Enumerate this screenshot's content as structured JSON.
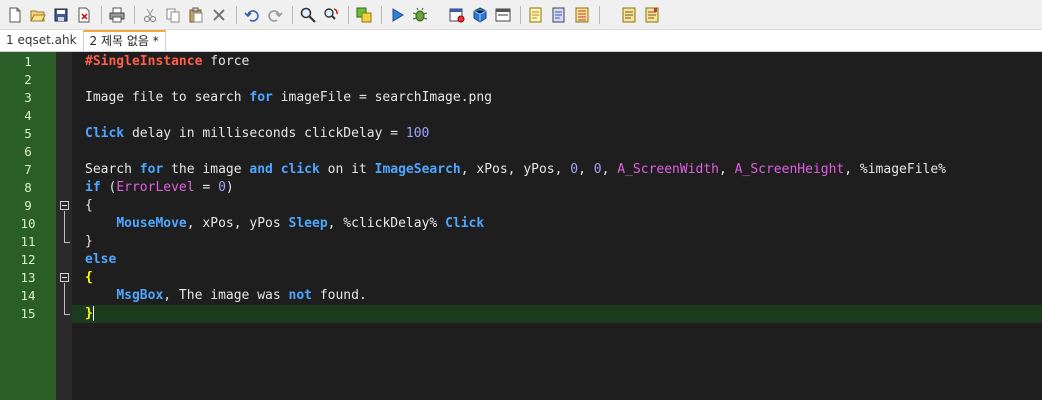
{
  "toolbar": {
    "buttons": [
      {
        "name": "new-file-icon",
        "icon": "new-file"
      },
      {
        "name": "open-folder-icon",
        "icon": "open-folder"
      },
      {
        "name": "save-icon",
        "icon": "save"
      },
      {
        "name": "close-file-icon",
        "icon": "close-file"
      },
      {
        "name": "print-icon",
        "icon": "print"
      },
      {
        "name": "cut-icon",
        "icon": "cut"
      },
      {
        "name": "copy-icon",
        "icon": "copy"
      },
      {
        "name": "paste-icon",
        "icon": "paste"
      },
      {
        "name": "delete-icon",
        "icon": "delete"
      },
      {
        "name": "undo-icon",
        "icon": "undo"
      },
      {
        "name": "redo-icon",
        "icon": "redo"
      },
      {
        "name": "find-icon",
        "icon": "find"
      },
      {
        "name": "replace-icon",
        "icon": "replace"
      },
      {
        "name": "language-icon",
        "icon": "language"
      },
      {
        "name": "run-icon",
        "icon": "run"
      },
      {
        "name": "debug-icon",
        "icon": "debug"
      },
      {
        "name": "window-spy-icon",
        "icon": "window-spy"
      },
      {
        "name": "compile-icon",
        "icon": "compile"
      },
      {
        "name": "window-icon",
        "icon": "window"
      },
      {
        "name": "notes-icon",
        "icon": "notes"
      },
      {
        "name": "reference-icon",
        "icon": "reference"
      },
      {
        "name": "doc-list-icon",
        "icon": "doc-list"
      },
      {
        "name": "bookmark-icon",
        "icon": "bookmark"
      },
      {
        "name": "bookmark-list-icon",
        "icon": "bookmark-list"
      }
    ]
  },
  "tabs": [
    {
      "label": "1 eqset.ahk",
      "active": false
    },
    {
      "label": "2 제목 없음 *",
      "active": true
    }
  ],
  "editor": {
    "line_numbers": [
      "1",
      "2",
      "3",
      "4",
      "5",
      "6",
      "7",
      "8",
      "9",
      "10",
      "11",
      "12",
      "13",
      "14",
      "15"
    ],
    "colors": {
      "gutter": "#2b5d27",
      "background": "#1e1e1e",
      "keyword": "#4fa6ff",
      "directive": "#ff5e4a",
      "variable": "#e060e0",
      "number": "#a0a0ff",
      "brace": "#ffff00"
    },
    "lines": [
      [
        {
          "t": "#SingleInstance",
          "c": "dir"
        },
        {
          "t": " force",
          "c": "plain"
        }
      ],
      [],
      [
        {
          "t": "Image file to search ",
          "c": "plain"
        },
        {
          "t": "for",
          "c": "kw"
        },
        {
          "t": " imageFile = searchImage.png",
          "c": "plain"
        }
      ],
      [],
      [
        {
          "t": "Click",
          "c": "cmd"
        },
        {
          "t": " delay in milliseconds clickDelay = ",
          "c": "plain"
        },
        {
          "t": "100",
          "c": "num"
        }
      ],
      [],
      [
        {
          "t": "Search ",
          "c": "plain"
        },
        {
          "t": "for",
          "c": "kw"
        },
        {
          "t": " the image ",
          "c": "plain"
        },
        {
          "t": "and",
          "c": "kw"
        },
        {
          "t": " ",
          "c": "plain"
        },
        {
          "t": "click",
          "c": "cmd"
        },
        {
          "t": " on it ",
          "c": "plain"
        },
        {
          "t": "ImageSearch",
          "c": "cmd"
        },
        {
          "t": ", xPos, yPos, ",
          "c": "plain"
        },
        {
          "t": "0",
          "c": "num"
        },
        {
          "t": ", ",
          "c": "plain"
        },
        {
          "t": "0",
          "c": "num"
        },
        {
          "t": ", ",
          "c": "plain"
        },
        {
          "t": "A_ScreenWidth",
          "c": "var"
        },
        {
          "t": ", ",
          "c": "plain"
        },
        {
          "t": "A_ScreenHeight",
          "c": "var"
        },
        {
          "t": ", %imageFile%",
          "c": "plain"
        }
      ],
      [
        {
          "t": "if",
          "c": "kw"
        },
        {
          "t": " (",
          "c": "plain"
        },
        {
          "t": "ErrorLevel",
          "c": "var"
        },
        {
          "t": " = ",
          "c": "plain"
        },
        {
          "t": "0",
          "c": "num"
        },
        {
          "t": ")",
          "c": "plain"
        }
      ],
      [
        {
          "t": "{",
          "c": "plain"
        }
      ],
      [
        {
          "t": "    ",
          "c": "plain"
        },
        {
          "t": "MouseMove",
          "c": "cmd"
        },
        {
          "t": ", xPos, yPos ",
          "c": "plain"
        },
        {
          "t": "Sleep",
          "c": "cmd"
        },
        {
          "t": ", %clickDelay% ",
          "c": "plain"
        },
        {
          "t": "Click",
          "c": "cmd"
        }
      ],
      [
        {
          "t": "}",
          "c": "plain"
        }
      ],
      [
        {
          "t": "else",
          "c": "kw"
        }
      ],
      [
        {
          "t": "{",
          "c": "brace"
        }
      ],
      [
        {
          "t": "    ",
          "c": "plain"
        },
        {
          "t": "MsgBox",
          "c": "cmd"
        },
        {
          "t": ", The image was ",
          "c": "plain"
        },
        {
          "t": "not",
          "c": "kw"
        },
        {
          "t": " found.",
          "c": "plain"
        }
      ],
      [
        {
          "t": "}",
          "c": "brace"
        },
        {
          "t": "",
          "c": "caret"
        }
      ]
    ],
    "current_line": 15,
    "fold_markers": [
      9,
      13
    ]
  }
}
